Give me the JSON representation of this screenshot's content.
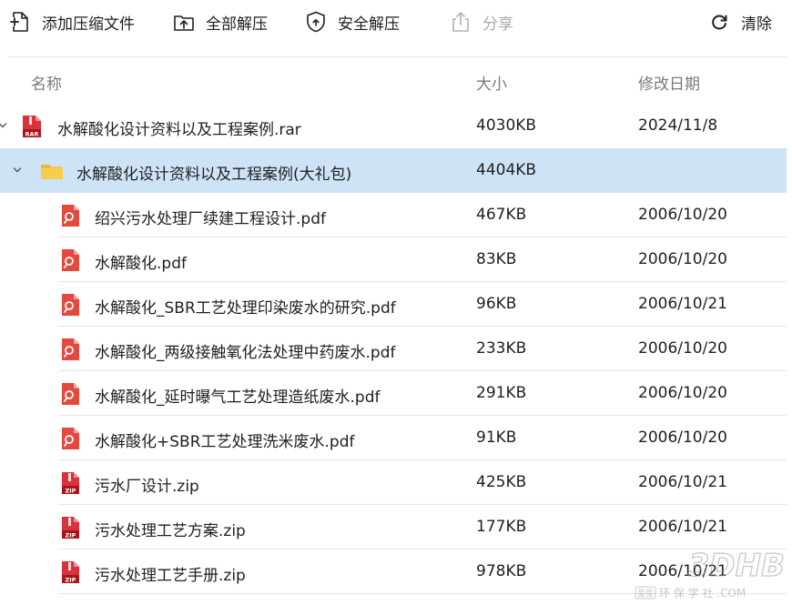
{
  "toolbar": {
    "add_label": "添加压缩文件",
    "extract_all_label": "全部解压",
    "safe_extract_label": "安全解压",
    "share_label": "分享",
    "clear_label": "清除"
  },
  "columns": {
    "name": "名称",
    "size": "大小",
    "date": "修改日期"
  },
  "rows": [
    {
      "name": "水解酸化设计资料以及工程案例.rar",
      "size": "4030KB",
      "date": "2024/11/8",
      "type": "rar",
      "level": 0
    },
    {
      "name": "水解酸化设计资料以及工程案例(大礼包)",
      "size": "4404KB",
      "date": "",
      "type": "folder",
      "level": 1
    },
    {
      "name": "绍兴污水处理厂续建工程设计.pdf",
      "size": "467KB",
      "date": "2006/10/20",
      "type": "pdf",
      "level": 2
    },
    {
      "name": "水解酸化.pdf",
      "size": "83KB",
      "date": "2006/10/20",
      "type": "pdf",
      "level": 2
    },
    {
      "name": "水解酸化_SBR工艺处理印染废水的研究.pdf",
      "size": "96KB",
      "date": "2006/10/21",
      "type": "pdf",
      "level": 2
    },
    {
      "name": "水解酸化_两级接触氧化法处理中药废水.pdf",
      "size": "233KB",
      "date": "2006/10/20",
      "type": "pdf",
      "level": 2
    },
    {
      "name": "水解酸化_延时曝气工艺处理造纸废水.pdf",
      "size": "291KB",
      "date": "2006/10/20",
      "type": "pdf",
      "level": 2
    },
    {
      "name": "水解酸化+SBR工艺处理洗米废水.pdf",
      "size": "91KB",
      "date": "2006/10/20",
      "type": "pdf",
      "level": 2
    },
    {
      "name": "污水厂设计.zip",
      "size": "425KB",
      "date": "2006/10/21",
      "type": "zip",
      "level": 2
    },
    {
      "name": "污水处理工艺方案.zip",
      "size": "177KB",
      "date": "2006/10/21",
      "type": "zip",
      "level": 2
    },
    {
      "name": "污水处理工艺手册.zip",
      "size": "978KB",
      "date": "2006/10/21",
      "type": "zip",
      "level": 2
    }
  ],
  "icons": {
    "add": "add-file-icon",
    "extract_all": "extract-icon",
    "safe_extract": "shield-icon",
    "share": "share-icon",
    "clear": "refresh-icon",
    "rar": "rar-file-icon",
    "folder": "folder-icon",
    "pdf": "pdf-file-icon",
    "zip": "zip-file-icon"
  },
  "watermark": {
    "logo_text": "3DHB",
    "sub_text": "环 保 学 社 .COM",
    "sub_badge": "蛋蛋"
  },
  "colors": {
    "selected_row": "#cfe3f7",
    "rar_red": "#d9323a",
    "pdf_red": "#e5483f",
    "folder_yellow": "#f6c342"
  }
}
